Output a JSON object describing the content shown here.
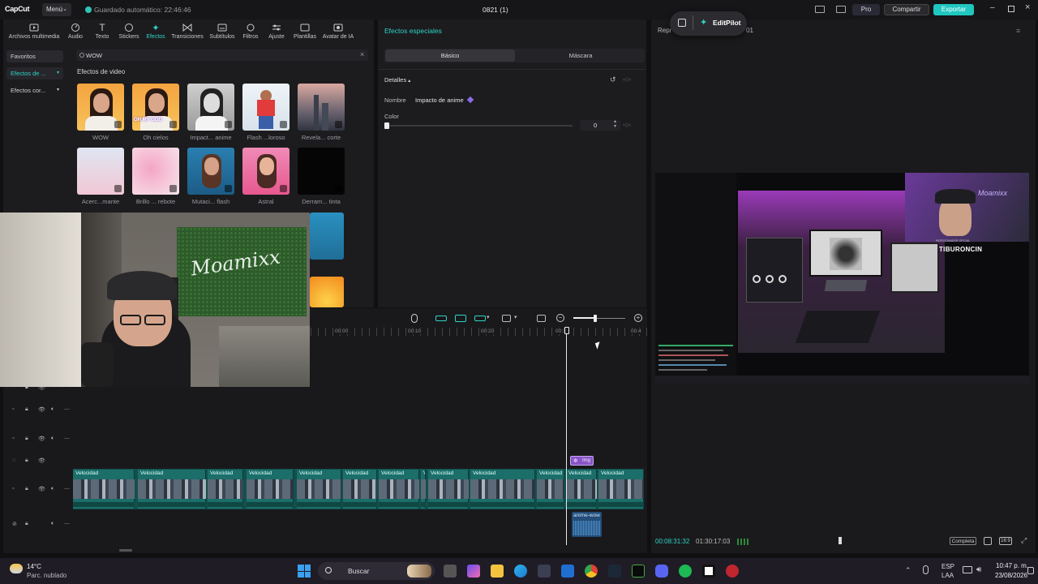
{
  "titlebar": {
    "app_name": "CapCut",
    "menu": "Menú",
    "autosave": "Guardado automático: 22:46:46",
    "project_title": "0821 (1)",
    "pro": "Pro",
    "share": "Compartir",
    "export": "Exportar"
  },
  "toolbar": {
    "items": [
      "Archivos multimedia",
      "Audio",
      "Texto",
      "Stickers",
      "Efectos",
      "Transiciones",
      "Subtítulos",
      "Filtros",
      "Ajuste",
      "Plantillas",
      "Avatar de IA"
    ],
    "active": "Efectos"
  },
  "effects_sidebar": {
    "items": [
      "Favoritos",
      "Efectos de ...",
      "Efectos cor..."
    ]
  },
  "search": {
    "value": "WOW"
  },
  "effects": {
    "section": "Efectos de video",
    "items": [
      {
        "label": "WOW"
      },
      {
        "label": "Oh cielos"
      },
      {
        "label": "Impact... anime"
      },
      {
        "label": "Flash ...loroso"
      },
      {
        "label": "Revela... corte"
      },
      {
        "label": "Acerc...mante"
      },
      {
        "label": "Brillo ... rebote"
      },
      {
        "label": "Mutaci... flash"
      },
      {
        "label": "Astral"
      },
      {
        "label": "Derram... tinta"
      }
    ],
    "thumb_text_oh": "OH MY GOD"
  },
  "special_effects": {
    "title": "Efectos especiales",
    "tabs": [
      "Básico",
      "Máscara"
    ],
    "details": "Detalles",
    "name_label": "Nombre",
    "name_value": "Impacto de anime",
    "color_label": "Color",
    "color_value": "0"
  },
  "preview": {
    "partial_label": "Repr",
    "partial_suffix": "01",
    "editpilot": "EditPilot",
    "current_time": "00:08:31:32",
    "total_time": "01:30:17:03",
    "full_button": "Completa",
    "ratio": "16:9",
    "stream_brand": "TIBURONCIN",
    "stream_sub": "PATROCINADOR OFICIAL",
    "wall_sign": "Moamixx"
  },
  "timeline": {
    "ruler": [
      "00:00",
      "00:10",
      "00:20",
      "00:3",
      "00:4"
    ],
    "clip_label": "Velocidad",
    "sticker_label": "Img",
    "audio_label": "anime-wow",
    "webcam_wall_sign": "Moamixx"
  },
  "taskbar": {
    "weather_temp": "14°C",
    "weather_desc": "Parc. nublado",
    "search": "Buscar",
    "lang": "ESP",
    "lang2": "LAA",
    "time": "10:47 p. m.",
    "date": "23/08/2026"
  },
  "colors": {
    "accent": "#2ed3c6",
    "export": "#1fc7c0",
    "clip": "#1f8a85",
    "sticker": "#8a55c8",
    "audio": "#2f6fa6"
  }
}
